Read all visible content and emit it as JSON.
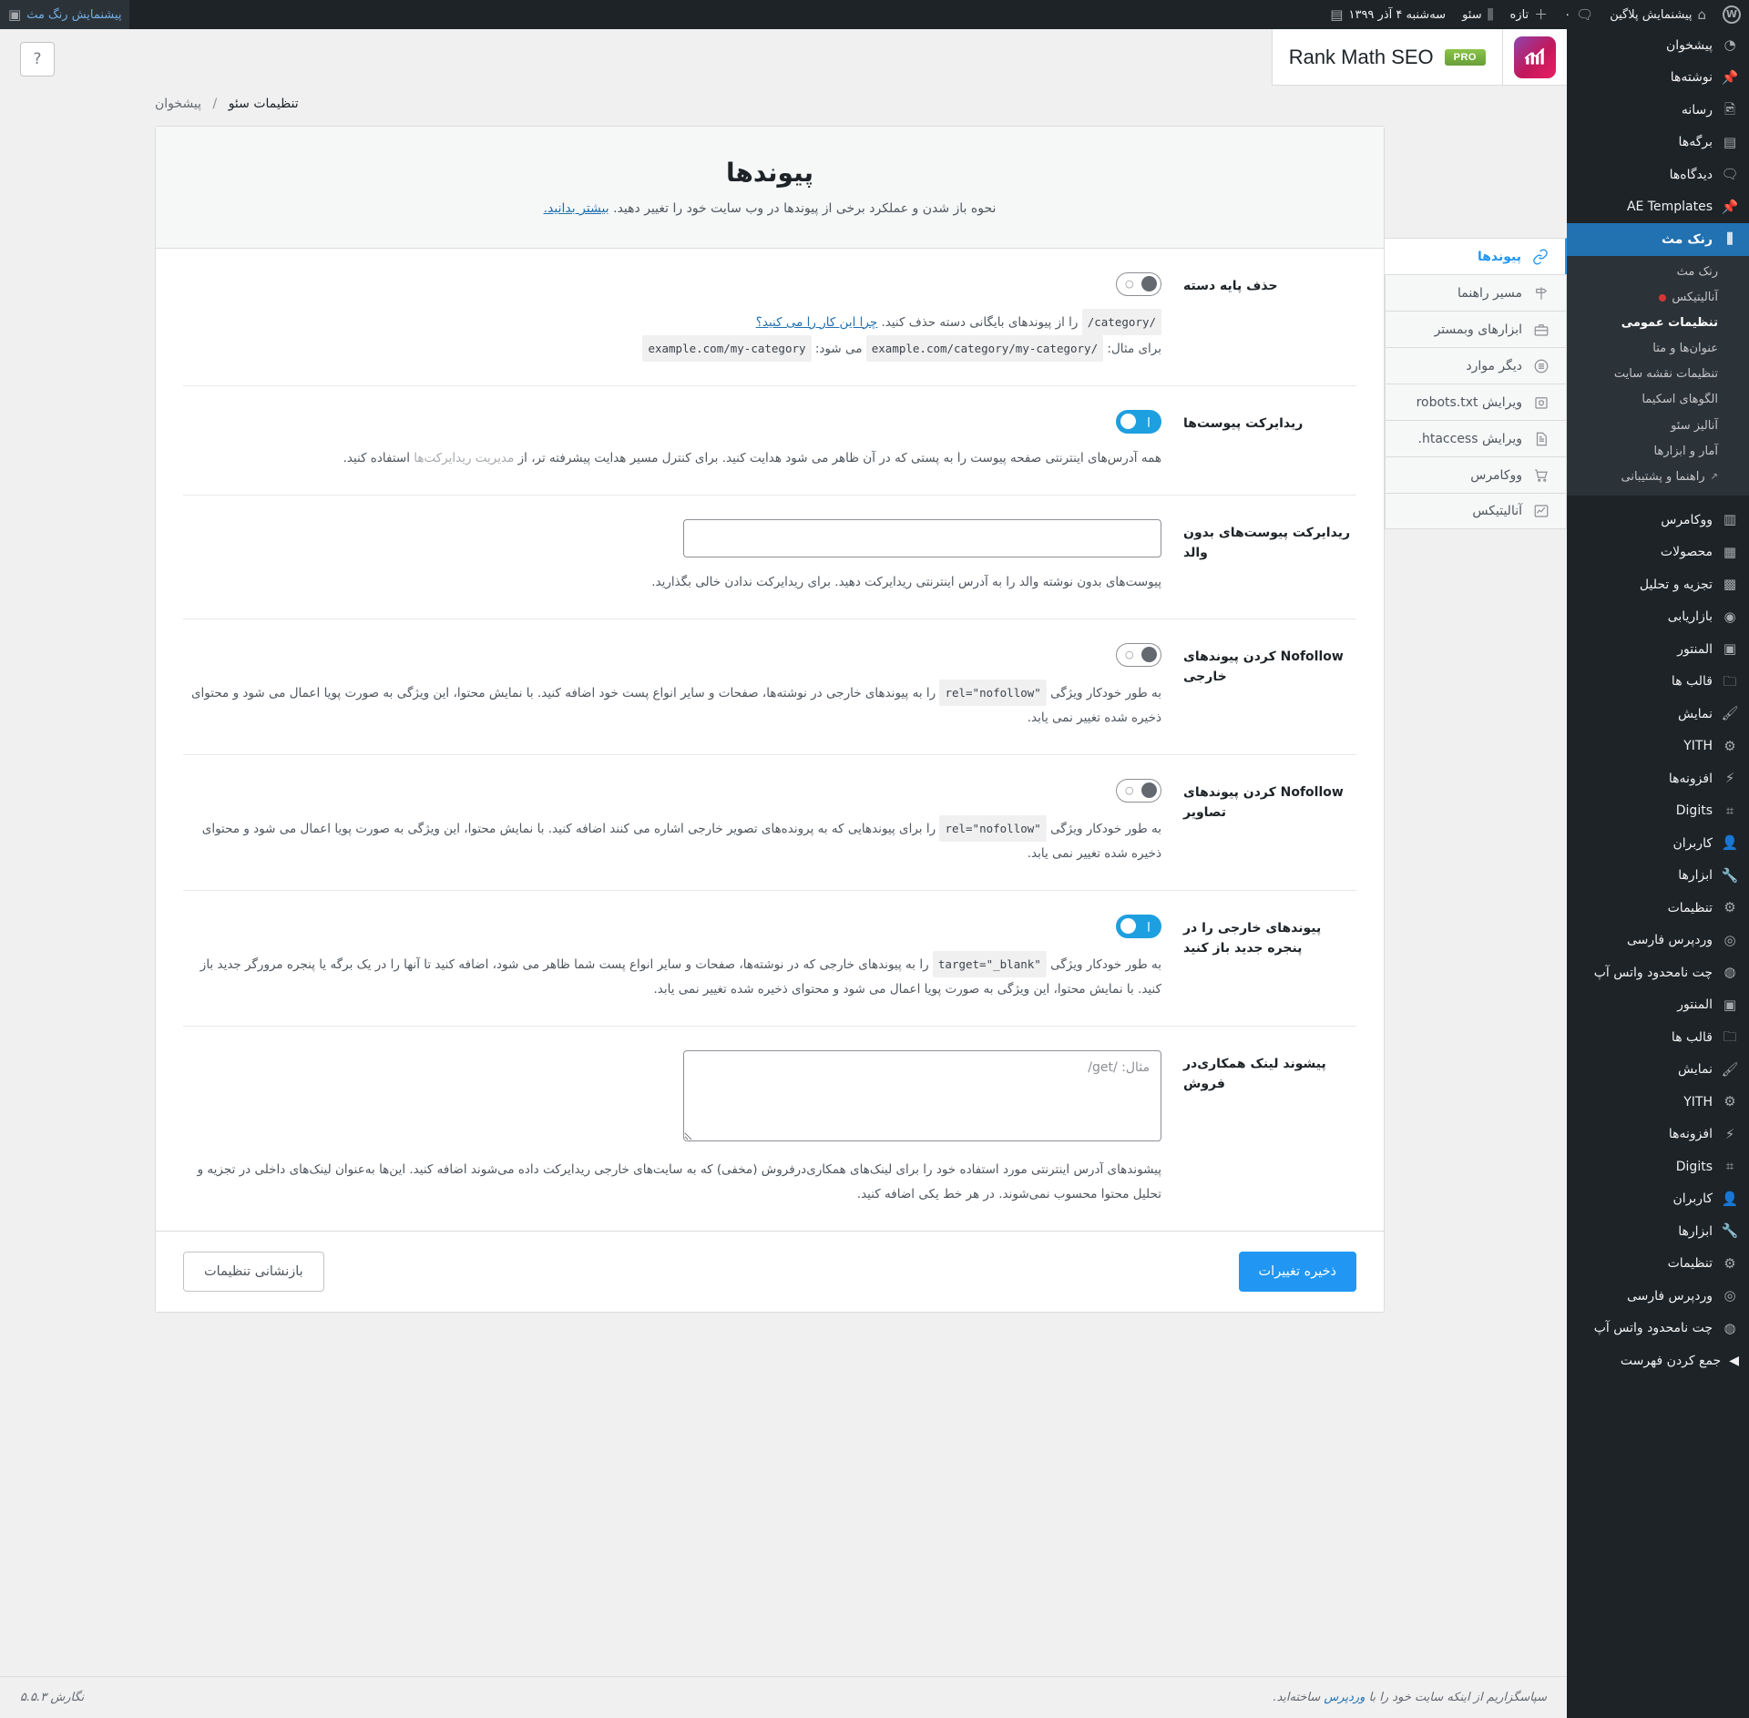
{
  "adminbar": {
    "site_name": "پیشنمایش پلاگین",
    "comments_count": "۰",
    "new_label": "تازه",
    "rankmath_label": "سئو",
    "date_label": "سه‌شنبه ۴ آذر ۱۳۹۹",
    "howdy": "پیشنمایش رنگ مث"
  },
  "sidebar": {
    "items": [
      {
        "label": "پیشخوان",
        "icon": "dashboard-icon"
      },
      {
        "label": "نوشته‌ها",
        "icon": "pin-icon"
      },
      {
        "label": "رسانه",
        "icon": "media-icon"
      },
      {
        "label": "برگه‌ها",
        "icon": "pages-icon"
      },
      {
        "label": "دیدگاه‌ها",
        "icon": "comments-icon"
      },
      {
        "label": "AE Templates",
        "icon": "pin-icon"
      }
    ],
    "rankmath": {
      "label": "رنک مث",
      "icon": "rankmath-icon"
    },
    "rankmath_submenu": [
      {
        "label": "رنک مث",
        "current": false,
        "dot": false
      },
      {
        "label": "آنالیتیکس",
        "current": false,
        "dot": true
      },
      {
        "label": "تنظیمات عمومی",
        "current": true,
        "dot": false
      },
      {
        "label": "عنوان‌ها و متا",
        "current": false,
        "dot": false
      },
      {
        "label": "تنظیمات نقشه سایت",
        "current": false,
        "dot": false
      },
      {
        "label": "الگوهای اسکیما",
        "current": false,
        "dot": false
      },
      {
        "label": "آنالیز سئو",
        "current": false,
        "dot": false
      },
      {
        "label": "آمار و ابزارها",
        "current": false,
        "dot": false
      },
      {
        "label": "راهنما و پشتیبانی",
        "current": false,
        "dot": false,
        "external": true
      }
    ],
    "items_after": [
      {
        "label": "ووکامرس",
        "icon": "woo-icon"
      },
      {
        "label": "محصولات",
        "icon": "box-icon"
      },
      {
        "label": "تجزیه و تحلیل",
        "icon": "chart-icon"
      },
      {
        "label": "بازاریابی",
        "icon": "megaphone-icon"
      },
      {
        "label": "المنتور",
        "icon": "elementor-icon"
      },
      {
        "label": "قالب ها",
        "icon": "folder-icon"
      },
      {
        "label": "نمایش",
        "icon": "appearance-icon"
      },
      {
        "label": "YITH",
        "icon": "yith-icon"
      },
      {
        "label": "افزونه‌ها",
        "icon": "plugins-icon"
      },
      {
        "label": "Digits",
        "icon": "digits-icon"
      },
      {
        "label": "کاربران",
        "icon": "users-icon"
      },
      {
        "label": "ابزارها",
        "icon": "tools-icon"
      },
      {
        "label": "تنظیمات",
        "icon": "settings-icon"
      },
      {
        "label": "وردپرس فارسی",
        "icon": "wpfa-icon"
      },
      {
        "label": "چت نامحدود واتس آپ",
        "icon": "whatsapp-icon"
      },
      {
        "label": "المنتور",
        "icon": "elementor-icon"
      },
      {
        "label": "قالب ها",
        "icon": "folder-icon"
      },
      {
        "label": "نمایش",
        "icon": "appearance-icon"
      },
      {
        "label": "YITH",
        "icon": "yith-icon"
      },
      {
        "label": "افزونه‌ها",
        "icon": "plugins-icon"
      },
      {
        "label": "Digits",
        "icon": "digits-icon"
      },
      {
        "label": "کاربران",
        "icon": "users-icon"
      },
      {
        "label": "ابزارها",
        "icon": "tools-icon"
      },
      {
        "label": "تنظیمات",
        "icon": "settings-icon"
      },
      {
        "label": "وردپرس فارسی",
        "icon": "wpfa-icon"
      },
      {
        "label": "چت نامحدود واتس آپ",
        "icon": "whatsapp-icon"
      }
    ],
    "collapse": "جمع کردن فهرست"
  },
  "header": {
    "plugin_title": "Rank Math SEO",
    "pro_badge": "PRO",
    "help_icon": "question-mark-icon"
  },
  "breadcrumb": {
    "root": "پیشخوان",
    "separator": "/",
    "current": "تنظیمات سئو"
  },
  "tabs": [
    {
      "label": "پیوندها",
      "icon": "link-icon",
      "active": true
    },
    {
      "label": "مسیر راهنما",
      "icon": "signpost-icon",
      "active": false
    },
    {
      "label": "ابزارهای وبمستر",
      "icon": "toolbox-icon",
      "active": false
    },
    {
      "label": "دیگر موارد",
      "icon": "list-icon",
      "active": false
    },
    {
      "label": "ویرایش robots.txt",
      "icon": "shield-folder-icon",
      "active": false
    },
    {
      "label": "ویرایش htaccess.",
      "icon": "document-icon",
      "active": false
    },
    {
      "label": "ووکامرس",
      "icon": "cart-icon",
      "active": false
    },
    {
      "label": "آنالیتیکس",
      "icon": "analytics-icon",
      "active": false
    }
  ],
  "panel": {
    "title": "پیوندها",
    "subtitle": "نحوه باز شدن و عملکرد برخی از پیوندها در وب سایت خود را تغییر دهید.",
    "subtitle_link": "بیشتر بدانید."
  },
  "fields": [
    {
      "id": "remove-category-base",
      "label": "حذف پایه دسته",
      "type": "toggle",
      "value": "off",
      "desc_pre": "",
      "desc_code1": "/category/",
      "desc_mid": "را از پیوندهای بایگانی دسته حذف کنید.",
      "desc_link": "چرا این کار را می کنید؟",
      "example_label": "برای مثال:",
      "example_from": "example.com/category/my-category/",
      "example_mid": "می شود:",
      "example_to": "example.com/my-category"
    },
    {
      "id": "redirect-attachments",
      "label": "ریدایرکت پیوست‌ها",
      "type": "toggle",
      "value": "on",
      "desc": "همه آدرس‌های اینترنتی صفحه پیوست را به پستی که در آن ظاهر می شود هدایت کنید. برای کنترل مسیر هدایت پیشرفته تر، از",
      "desc_link": "مدیریت ریدایرکت‌ها",
      "desc_after": "استفاده کنید."
    },
    {
      "id": "redirect-orphan-attachments",
      "label": "ریدایرکت پیوست‌های بدون والد",
      "type": "text",
      "value": "",
      "placeholder": "",
      "desc": "پیوست‌های بدون نوشته والد را به آدرس اینترنتی ریدایرکت دهید. برای ریدایرکت ندادن خالی بگذارید."
    },
    {
      "id": "nofollow-external-links",
      "label": "Nofollow کردن پیوندهای خارجی",
      "type": "toggle",
      "value": "off",
      "desc_pre": "به طور خودکار ویژگی",
      "desc_code": "rel=\"nofollow\"",
      "desc_post": "را به پیوندهای خارجی در نوشته‌ها، صفحات و سایر انواع پست خود اضافه کنید. با نمایش محتوا، این ویژگی به صورت پویا اعمال می شود و محتوای ذخیره شده تغییر نمی یابد."
    },
    {
      "id": "nofollow-image-links",
      "label": "Nofollow کردن پیوندهای تصاویر",
      "type": "toggle",
      "value": "off",
      "desc_pre": "به طور خودکار ویژگی",
      "desc_code": "rel=\"nofollow\"",
      "desc_post": "را برای پیوندهایی که به پرونده‌های تصویر خارجی اشاره می کنند اضافه کنید. با نمایش محتوا، این ویژگی به صورت پویا اعمال می شود و محتوای ذخیره شده تغییر نمی یابد."
    },
    {
      "id": "open-external-links-new-tab",
      "label": "پیوندهای خارجی را در پنجره جدید باز کنید",
      "type": "toggle",
      "value": "on",
      "desc_pre": "به طور خودکار ویژگی",
      "desc_code": "target=\"_blank\"",
      "desc_post": "را به پیوندهای خارجی که در نوشته‌ها، صفحات و سایر انواع پست شما ظاهر می شود، اضافه کنید تا آنها را در یک برگه یا پنجره مرورگر جدید باز کنید. با نمایش محتوا، این ویژگی به صورت پویا اعمال می شود و محتوای ذخیره شده تغییر نمی یابد."
    },
    {
      "id": "affiliate-link-prefix",
      "label": "پیشوند لینک همکاری‌در فروش",
      "type": "textarea",
      "value": "",
      "placeholder": "مثال: /get/",
      "desc": "پیشوندهای آدرس اینترنتی مورد استفاده خود را برای لینک‌های همکاری‌درفروش (مخفی) که به سایت‌های خارجی ریدایرکت داده می‌شوند اضافه کنید. این‌ها به‌عنوان لینک‌های داخلی در تجزیه و تحلیل محتوا محسوب نمی‌شوند. در هر خط یکی اضافه کنید."
    }
  ],
  "footer_actions": {
    "save": "ذخیره تغییرات",
    "reset": "بازنشانی تنظیمات"
  },
  "page_footer": {
    "thanks_pre": "سپاسگزاریم از اینکه سایت خود را با",
    "thanks_link": "وردپرس",
    "thanks_post": "ساخته‌اید.",
    "version": "نگارش ۵.۵.۳"
  },
  "colors": {
    "accent": "#2196f3",
    "admin_bg": "#1d2327",
    "current_menu": "#2271b1",
    "toggle_on": "#1e9fe0",
    "pro_green": "#8bc34a"
  }
}
